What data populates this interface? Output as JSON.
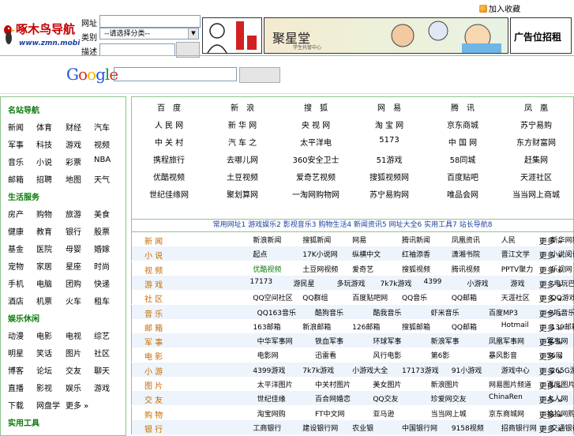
{
  "header": {
    "favorite_label": "加入收藏",
    "logo_text": "啄木鸟导航",
    "logo_domain": "www.zmn.mobi",
    "form_labels": [
      "网址",
      "类别",
      "描述"
    ],
    "select_value": "--请选择分类--",
    "ads": {
      "ad2_title": "聚星堂",
      "ad2_subtitle": "学生托管中心",
      "ad3_label": "广告位招租"
    }
  },
  "google": {
    "logo": "Google",
    "logo_colors": [
      "#1a55e8",
      "#d62d20",
      "#f4b400",
      "#1a55e8",
      "#0a9a3a",
      "#d62d20"
    ]
  },
  "sidebar": {
    "sections": [
      {
        "title": "名站导航",
        "items": [
          [
            "新闻",
            "体育",
            "财经",
            "汽车"
          ],
          [
            "军事",
            "科技",
            "游戏",
            "视频"
          ],
          [
            "音乐",
            "小说",
            "彩票",
            "NBA"
          ],
          [
            "邮箱",
            "招聘",
            "地图",
            "天气"
          ]
        ]
      },
      {
        "title": "生活服务",
        "items": [
          [
            "房产",
            "购物",
            "旅游",
            "美食"
          ],
          [
            "健康",
            "教育",
            "银行",
            "股票"
          ],
          [
            "基金",
            "医院",
            "母婴",
            "婚嫁"
          ],
          [
            "宠物",
            "家居",
            "星座",
            "时尚"
          ],
          [
            "手机",
            "电脑",
            "团购",
            "快递"
          ],
          [
            "酒店",
            "机票",
            "火车",
            "租车"
          ]
        ]
      },
      {
        "title": "娱乐休闲",
        "items": [
          [
            "动漫",
            "电影",
            "电视",
            "综艺"
          ],
          [
            "明星",
            "笑话",
            "图片",
            "社区"
          ],
          [
            "博客",
            "论坛",
            "交友",
            "聊天"
          ],
          [
            "直播",
            "影视",
            "娱乐",
            "游戏"
          ],
          [
            "下载",
            "网盘学",
            "更多 »"
          ]
        ]
      },
      {
        "title": "实用工具",
        "items": []
      }
    ]
  },
  "grid": [
    [
      "百　度",
      "新　浪",
      "搜　狐",
      "网　易",
      "腾　讯",
      "凤　凰"
    ],
    [
      "人 民 网",
      "新 华 网",
      "央 视 网",
      "淘 宝 网",
      "京东商城",
      "苏宁易购"
    ],
    [
      "中 关 村",
      "汽 车 之",
      "太平洋电",
      "5173",
      "中 国 网",
      "东方财富网"
    ],
    [
      "携程旅行",
      "去哪儿网",
      "360安全卫士",
      "51游戏",
      "58同城",
      "赶集网"
    ],
    [
      "优酷视频",
      "土豆视频",
      "爱奇艺视频",
      "搜狐视频网",
      "百度贴吧",
      "天涯社区"
    ],
    [
      "世纪佳缘网",
      "聚划算网",
      "一淘网购物网",
      "苏宁易购网",
      "唯品会网",
      "当当网上商城"
    ]
  ],
  "tabs_text": "常用网址1 游戏娱乐2 影视音乐3 购物生活4 新闻资讯5 网址大全6 实用工具7 站长导航8",
  "rows": [
    {
      "cat": "新 闻",
      "links": [
        "新浪新闻",
        "搜狐新闻",
        "网易",
        "腾讯新闻",
        "凤凰资讯",
        "人民",
        "新华网新闻"
      ],
      "more": "更多 »"
    },
    {
      "cat": "小 说",
      "links": [
        "起点",
        "17K小说网",
        "纵横中文",
        "红袖添香",
        "潇湘书院",
        "晋江文学",
        "小说阅读网"
      ],
      "more": "更多 »"
    },
    {
      "cat": "视 频",
      "links": [
        "优酷视频",
        "土豆网视频",
        "爱奇艺",
        "搜狐视频",
        "腾讯视频",
        "PPTV聚力",
        "乐视网"
      ],
      "more": "更多 »"
    },
    {
      "cat": "游 戏",
      "links": [
        "17173",
        "游民星",
        "多玩游戏",
        "7k7k游戏",
        "4399",
        "小游戏",
        "游戏",
        "电玩巴士"
      ],
      "more": "更多 »"
    },
    {
      "cat": "社 区",
      "links": [
        "QQ空间社区",
        "QQ群组",
        "百度贴吧网",
        "QQ音乐",
        "QQ邮箱",
        "天涯社区",
        "QQ游戏"
      ],
      "more": "更多 »"
    },
    {
      "cat": "音 乐",
      "links": [
        "QQ163音乐",
        "酷狗音乐",
        "酷我音乐",
        "虾米音乐",
        "百度MP3",
        "一听音乐网"
      ],
      "more": "更多 »"
    },
    {
      "cat": "邮 箱",
      "links": [
        "163邮箱",
        "新浪邮箱",
        "126邮箱",
        "搜狐邮箱",
        "QQ邮箱",
        "Hotmail",
        "139邮箱"
      ],
      "more": "更多 »"
    },
    {
      "cat": "军 事",
      "links": [
        "中华军事网",
        "铁血军事",
        "环球军事",
        "新浪军事",
        "凤凰军事网",
        "军事网"
      ],
      "more": "更多 »"
    },
    {
      "cat": "电 影",
      "links": [
        "电影网",
        "迅雷看",
        "风行电影",
        "第6影",
        "暴风影音",
        "56网"
      ],
      "more": "更多 »"
    },
    {
      "cat": "小 游",
      "links": [
        "4399游戏",
        "7k7k游戏",
        "小游戏大全",
        "17173游戏",
        "91小游戏",
        "游戏中心",
        "265G游戏"
      ],
      "more": "更多 »"
    },
    {
      "cat": "图 片",
      "links": [
        "太平洋图片",
        "中关村图片",
        "美女图片",
        "新浪图片",
        "网易图片频道",
        "百度图片"
      ],
      "more": "更多 »"
    },
    {
      "cat": "交 友",
      "links": [
        "世纪佳缘",
        "百合网婚恋",
        "QQ交友",
        "珍爱网交友",
        "ChinaRen",
        "人人网"
      ],
      "more": "更多 »"
    },
    {
      "cat": "购 物",
      "links": [
        "淘宝网购",
        "FT中文网",
        "亚马逊",
        "当当网上城",
        "京东商城网",
        "拍拍网购物"
      ],
      "more": "更多 »"
    },
    {
      "cat": "银 行",
      "links": [
        "工商银行",
        "建设银行网",
        "农业银",
        "中国银行网",
        "9158视频",
        "招商银行网",
        "交通银行"
      ],
      "more": "更多 »"
    }
  ]
}
